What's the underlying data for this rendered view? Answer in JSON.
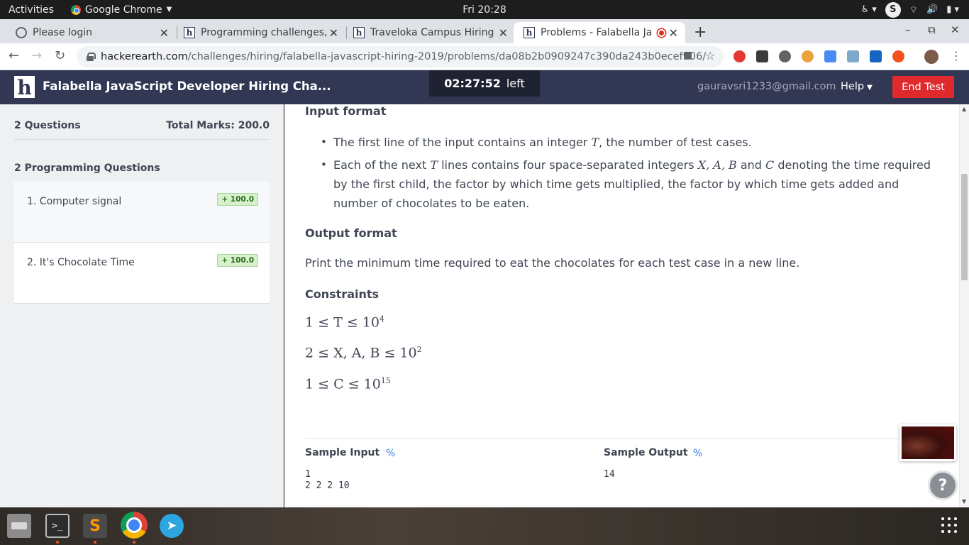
{
  "os_bar": {
    "activities": "Activities",
    "app_name": "Google Chrome",
    "clock": "Fri 20:28",
    "s_badge": "S"
  },
  "tabs": [
    {
      "title": "Please login",
      "icon": "globe-icon"
    },
    {
      "title": "Programming challenges,",
      "icon": "hackerearth-icon"
    },
    {
      "title": "Traveloka Campus Hiring",
      "icon": "hackerearth-icon"
    },
    {
      "title": "Problems - Falabella Ja",
      "icon": "hackerearth-icon",
      "active": true
    }
  ],
  "address_bar": {
    "host": "hackerearth.com",
    "path": "/challenges/hiring/falabella-javascript-hiring-2019/problems/da08b2b0909247c390da243b0ecef906/"
  },
  "header": {
    "logo": "h",
    "title": "Falabella JavaScript Developer Hiring Cha...",
    "timer": "02:27:52",
    "timer_suffix": "left",
    "email": "gauravsri1233@gmail.com",
    "help": "Help",
    "end_test": "End Test",
    "end_test_color": "#e0292c",
    "header_color": "#323754"
  },
  "sidebar": {
    "questions_count": "2 Questions",
    "total_marks": "Total Marks: 200.0",
    "section_title": "2 Programming Questions",
    "questions": [
      {
        "name": "1. Computer signal",
        "marks": "+ 100.0"
      },
      {
        "name": "2. It's Chocolate Time",
        "marks": "+ 100.0"
      }
    ]
  },
  "problem": {
    "input_format_heading": "Input format",
    "input_lines": [
      {
        "pre": "The first line of the input contains an integer ",
        "math": "T",
        "post": ", the number of test cases."
      },
      {
        "pre": "Each of the next ",
        "math": "T",
        "mid": " lines contains four space-separated integers ",
        "math2": "X, A, B",
        "and": " and ",
        "math3": "C",
        "post": " denoting the time required by the first child, the factor by which time gets multiplied, the factor by which time gets added and number of chocolates to be eaten."
      }
    ],
    "output_format_heading": "Output format",
    "output_text": "Print the minimum time required to eat the chocolates for each test case in a new line.",
    "constraints_heading": "Constraints",
    "constraints": [
      {
        "expr": "1 ≤ T ≤ 10",
        "exp": "4"
      },
      {
        "expr": "2 ≤ X, A, B ≤ 10",
        "exp": "2"
      },
      {
        "expr": "1 ≤ C ≤ 10",
        "exp": "15"
      }
    ],
    "sample_input_heading": "Sample Input",
    "sample_input": "1\n2 2 2 10",
    "sample_output_heading": "Sample Output",
    "sample_output": "14"
  },
  "help_fab": "?"
}
